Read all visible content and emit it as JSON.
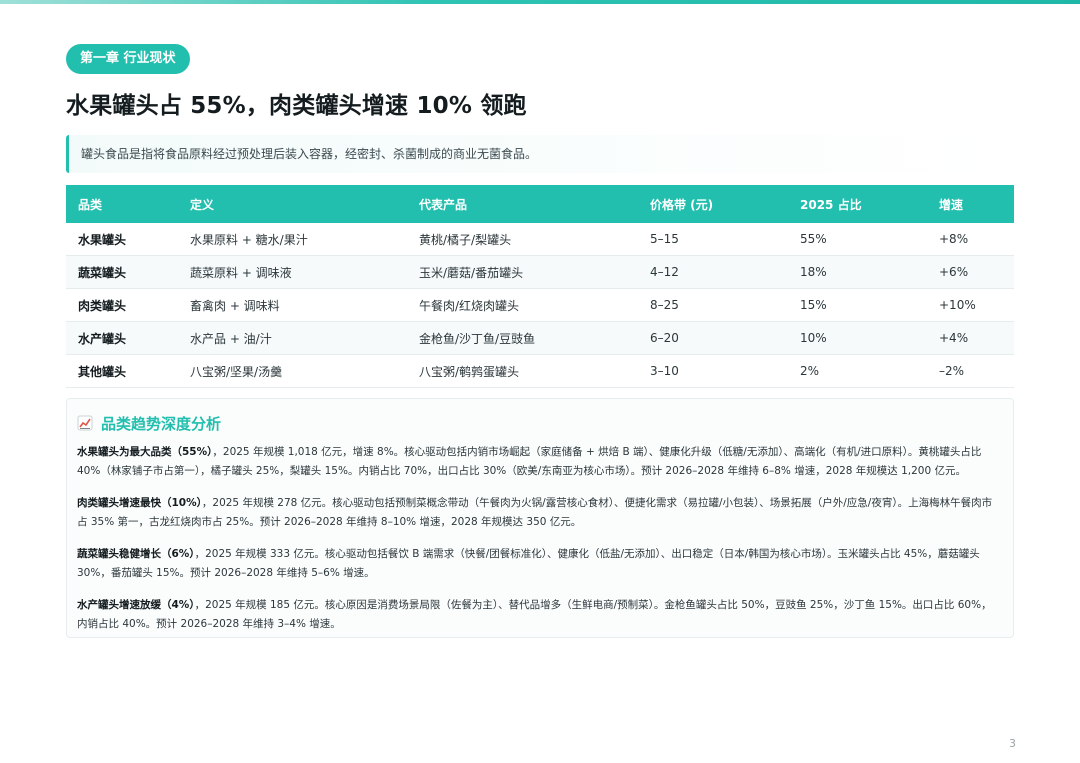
{
  "badge": "第一章 行业现状",
  "title": "水果罐头占 55%，肉类罐头增速 10% 领跑",
  "intro": "罐头食品是指将食品原料经过预处理后装入容器，经密封、杀菌制成的商业无菌食品。",
  "table": {
    "headers": [
      "品类",
      "定义",
      "代表产品",
      "价格带 (元)",
      "2025 占比",
      "增速"
    ],
    "rows": [
      {
        "category": "水果罐头",
        "definition": "水果原料 + 糖水/果汁",
        "products": "黄桃/橘子/梨罐头",
        "price": "5–15",
        "share": "55%",
        "growth": "+8%",
        "trend": "up"
      },
      {
        "category": "蔬菜罐头",
        "definition": "蔬菜原料 + 调味液",
        "products": "玉米/蘑菇/番茄罐头",
        "price": "4–12",
        "share": "18%",
        "growth": "+6%",
        "trend": "up"
      },
      {
        "category": "肉类罐头",
        "definition": "畜禽肉 + 调味料",
        "products": "午餐肉/红烧肉罐头",
        "price": "8–25",
        "share": "15%",
        "growth": "+10%",
        "trend": "up"
      },
      {
        "category": "水产罐头",
        "definition": "水产品 + 油/汁",
        "products": "金枪鱼/沙丁鱼/豆豉鱼",
        "price": "6–20",
        "share": "10%",
        "growth": "+4%",
        "trend": "flat"
      },
      {
        "category": "其他罐头",
        "definition": "八宝粥/坚果/汤羹",
        "products": "八宝粥/鹌鹑蛋罐头",
        "price": "3–10",
        "share": "2%",
        "growth": "–2%",
        "trend": "down"
      }
    ]
  },
  "colors": {
    "accent": "#22bfae",
    "up": "#24b09c",
    "down": "#e2664b"
  },
  "analysis": {
    "icon": "trend-chart-icon",
    "title": "品类趋势深度分析",
    "paragraphs": [
      {
        "lead": "水果罐头为最大品类（55%）",
        "body": "，2025 年规模 1,018 亿元，增速 8%。核心驱动包括内销市场崛起（家庭储备 + 烘焙 B 端）、健康化升级（低糖/无添加）、高端化（有机/进口原料）。黄桃罐头占比 40%（林家铺子市占第一），橘子罐头 25%，梨罐头 15%。内销占比 70%，出口占比 30%（欧美/东南亚为核心市场）。预计 2026–2028 年维持 6–8% 增速，2028 年规模达 1,200 亿元。"
      },
      {
        "lead": "肉类罐头增速最快（10%）",
        "body": "，2025 年规模 278 亿元。核心驱动包括预制菜概念带动（午餐肉为火锅/露营核心食材）、便捷化需求（易拉罐/小包装）、场景拓展（户外/应急/夜宵）。上海梅林午餐肉市占 35% 第一，古龙红烧肉市占 25%。预计 2026–2028 年维持 8–10% 增速，2028 年规模达 350 亿元。"
      },
      {
        "lead": "蔬菜罐头稳健增长（6%）",
        "body": "，2025 年规模 333 亿元。核心驱动包括餐饮 B 端需求（快餐/团餐标准化）、健康化（低盐/无添加）、出口稳定（日本/韩国为核心市场）。玉米罐头占比 45%，蘑菇罐头 30%，番茄罐头 15%。预计 2026–2028 年维持 5–6% 增速。"
      },
      {
        "lead": "水产罐头增速放缓（4%）",
        "body": "，2025 年规模 185 亿元。核心原因是消费场景局限（佐餐为主）、替代品增多（生鲜电商/预制菜）。金枪鱼罐头占比 50%，豆豉鱼 25%，沙丁鱼 15%。出口占比 60%，内销占比 40%。预计 2026–2028 年维持 3–4% 增速。"
      }
    ]
  },
  "page_number": "3"
}
